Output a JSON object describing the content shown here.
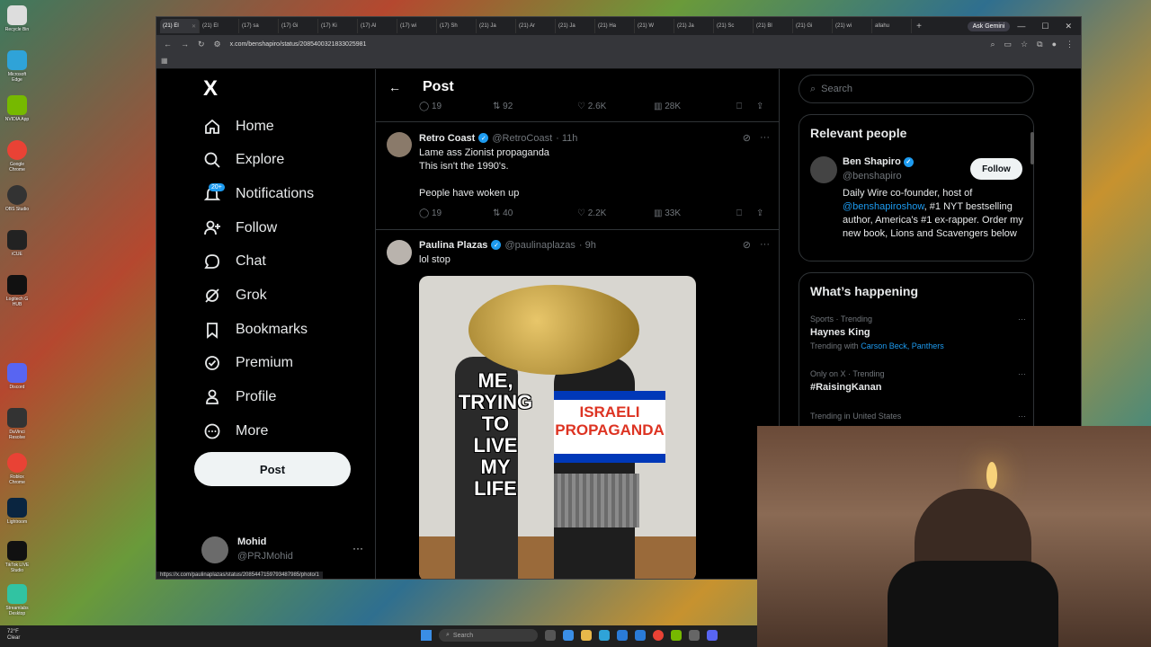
{
  "desktop": {
    "icons": [
      "Recycle Bin",
      "Microsoft Edge",
      "NVIDIA App",
      "Google Chrome",
      "OBS Studio",
      "iCUE",
      "Logitech G HUB",
      "Discord",
      "DaVinci Resolve",
      "Roblox Chrome",
      "Lightroom",
      "TikTok LIVE Studio",
      "Streamlabs Desktop"
    ]
  },
  "browser": {
    "tabs": [
      "(21) El",
      "(21) El",
      "(17) sa",
      "(17) Gi",
      "(17) Ki",
      "(17) Al",
      "(17) wi",
      "(17) Sh",
      "(21) Ja",
      "(21) Ar",
      "(21) Ja",
      "(21) Ha",
      "(21) W",
      "(21) Ja",
      "(21) Sc",
      "(21) Bl",
      "(21) Gi",
      "(21) wi",
      "allahu"
    ],
    "ask_gemini": "Ask Gemini",
    "url": "x.com/benshapiro/status/2085400321833025981",
    "status_url": "https://x.com/paulinaplazas/status/2085447159793487985/photo/1"
  },
  "nav": {
    "logo": "X",
    "items": [
      {
        "label": "Home"
      },
      {
        "label": "Explore"
      },
      {
        "label": "Notifications",
        "badge": "20+"
      },
      {
        "label": "Follow"
      },
      {
        "label": "Chat"
      },
      {
        "label": "Grok"
      },
      {
        "label": "Bookmarks"
      },
      {
        "label": "Premium"
      },
      {
        "label": "Profile"
      },
      {
        "label": "More"
      }
    ],
    "post_button": "Post",
    "account": {
      "name": "Mohid",
      "handle": "@PRJMohid"
    }
  },
  "center": {
    "title": "Post",
    "prev_stats": {
      "replies": "19",
      "reposts": "92",
      "likes": "2.6K",
      "views": "28K"
    },
    "tweets": [
      {
        "name": "Retro Coast",
        "handle": "@RetroCoast",
        "time": "· 11h",
        "lines": [
          "Lame ass Zionist propaganda",
          "This isn't the 1990's.",
          "",
          "People have woken up"
        ],
        "stats": {
          "replies": "19",
          "reposts": "40",
          "likes": "2.2K",
          "views": "33K"
        }
      },
      {
        "name": "Paulina Plazas",
        "handle": "@paulinaplazas",
        "time": "· 9h",
        "lines": [
          "lol stop"
        ],
        "meme_caption": [
          "ME,",
          "TRYING",
          "TO",
          "LIVE",
          "MY",
          "LIFE"
        ],
        "meme_flag_text": [
          "ISRAELI",
          "PROPAGANDA"
        ]
      }
    ]
  },
  "right": {
    "search_placeholder": "Search",
    "relevant_title": "Relevant people",
    "person": {
      "name": "Ben Shapiro",
      "handle": "@benshapiro",
      "follow": "Follow",
      "bio_1": "Daily Wire co-founder, host of",
      "bio_link": "@benshapiroshow",
      "bio_2": ", #1 NYT bestselling author, America's #1 ex-rapper. Order my new book, Lions and Scavengers below"
    },
    "happening_title": "What’s happening",
    "trends": [
      {
        "context": "Sports · Trending",
        "title": "Haynes King",
        "with_label": "Trending with",
        "with_links": "Carson Beck, Panthers"
      },
      {
        "context": "Only on X · Trending",
        "title": "#RaisingKanan"
      },
      {
        "context": "Trending in United States",
        "title": ""
      }
    ]
  },
  "taskbar": {
    "weather_temp": "72°F",
    "weather_cond": "Clear",
    "search": "Search"
  }
}
